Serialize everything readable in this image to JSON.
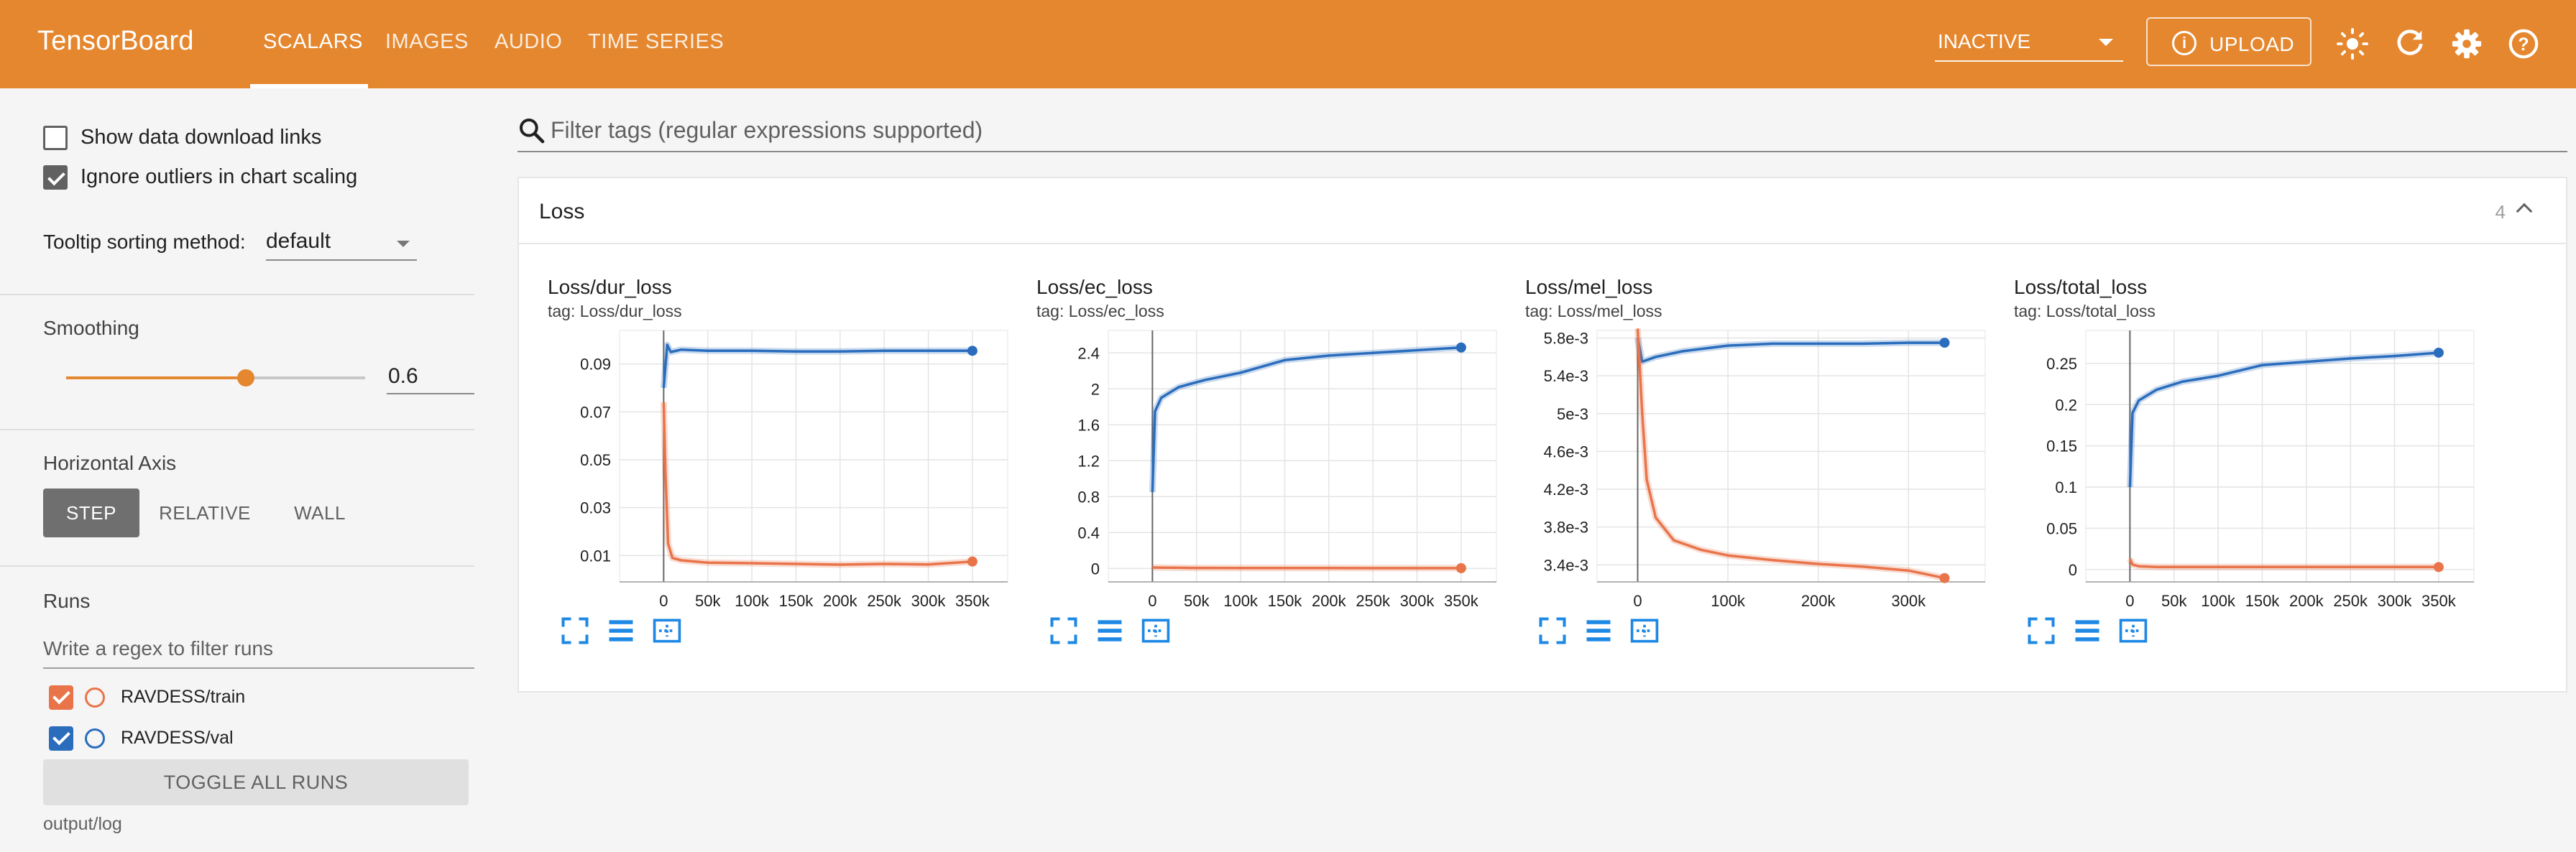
{
  "app": {
    "title": "TensorBoard",
    "tabs": [
      {
        "label": "SCALARS",
        "active": true
      },
      {
        "label": "IMAGES",
        "active": false
      },
      {
        "label": "AUDIO",
        "active": false
      },
      {
        "label": "TIME SERIES",
        "active": false
      }
    ],
    "run_status": "INACTIVE",
    "upload_label": "UPLOAD",
    "accent_color": "#e5872f",
    "icons": [
      "theme-brightness-icon",
      "refresh-icon",
      "settings-gear-icon",
      "help-icon"
    ]
  },
  "sidebar": {
    "show_download_links": {
      "label": "Show data download links",
      "checked": false
    },
    "ignore_outliers": {
      "label": "Ignore outliers in chart scaling",
      "checked": true
    },
    "tooltip_sorting": {
      "label": "Tooltip sorting method:",
      "value": "default"
    },
    "smoothing": {
      "label": "Smoothing",
      "value": "0.6",
      "level": 0.6
    },
    "horizontal_axis": {
      "label": "Horizontal Axis",
      "options": [
        "STEP",
        "RELATIVE",
        "WALL"
      ],
      "selected": "STEP"
    },
    "runs": {
      "label": "Runs",
      "filter_placeholder": "Write a regex to filter runs",
      "items": [
        {
          "name": "RAVDESS/train",
          "color": "#e9744a",
          "checked": true
        },
        {
          "name": "RAVDESS/val",
          "color": "#2a6dbd",
          "checked": true
        }
      ],
      "toggle_label": "TOGGLE ALL RUNS",
      "log_dir": "output/log"
    }
  },
  "main": {
    "filter_placeholder": "Filter tags (regular expressions supported)",
    "group": {
      "title": "Loss",
      "count": "4"
    }
  },
  "chart_data": [
    {
      "type": "line",
      "title": "Loss/dur_loss",
      "tag": "tag: Loss/dur_loss",
      "xlabel": "",
      "ylabel": "",
      "xlim": [
        -50000,
        390000
      ],
      "ylim": [
        -0.001,
        0.104
      ],
      "xticks": [
        0,
        50000,
        100000,
        150000,
        200000,
        250000,
        300000,
        350000
      ],
      "xtick_labels": [
        "0",
        "50k",
        "100k",
        "150k",
        "200k",
        "250k",
        "300k",
        "350k"
      ],
      "yticks": [
        0.01,
        0.03,
        0.05,
        0.07,
        0.09
      ],
      "ytick_labels": [
        "0.01",
        "0.03",
        "0.05",
        "0.07",
        "0.09"
      ],
      "grid": true,
      "series": [
        {
          "name": "RAVDESS/val",
          "color": "#2a6dbd",
          "x": [
            0,
            4000,
            8000,
            20000,
            50000,
            100000,
            150000,
            200000,
            250000,
            300000,
            350000
          ],
          "y": [
            0.08,
            0.098,
            0.095,
            0.096,
            0.0955,
            0.0955,
            0.0952,
            0.0952,
            0.0955,
            0.0955,
            0.0955
          ]
        },
        {
          "name": "RAVDESS/train",
          "color": "#e9744a",
          "x": [
            0,
            2000,
            5000,
            10000,
            20000,
            50000,
            100000,
            150000,
            200000,
            250000,
            300000,
            350000
          ],
          "y": [
            0.074,
            0.045,
            0.015,
            0.009,
            0.008,
            0.007,
            0.0068,
            0.0065,
            0.0062,
            0.0065,
            0.0063,
            0.0075
          ]
        }
      ]
    },
    {
      "type": "line",
      "title": "Loss/ec_loss",
      "tag": "tag: Loss/ec_loss",
      "xlabel": "",
      "ylabel": "",
      "xlim": [
        -50000,
        390000
      ],
      "ylim": [
        -0.15,
        2.65
      ],
      "xticks": [
        0,
        50000,
        100000,
        150000,
        200000,
        250000,
        300000,
        350000
      ],
      "xtick_labels": [
        "0",
        "50k",
        "100k",
        "150k",
        "200k",
        "250k",
        "300k",
        "350k"
      ],
      "yticks": [
        0,
        0.4,
        0.8,
        1.2,
        1.6,
        2,
        2.4
      ],
      "ytick_labels": [
        "0",
        "0.4",
        "0.8",
        "1.2",
        "1.6",
        "2",
        "2.4"
      ],
      "grid": true,
      "series": [
        {
          "name": "RAVDESS/val",
          "color": "#2a6dbd",
          "x": [
            0,
            3000,
            10000,
            30000,
            60000,
            100000,
            150000,
            200000,
            250000,
            300000,
            350000
          ],
          "y": [
            0.85,
            1.75,
            1.9,
            2.02,
            2.1,
            2.18,
            2.32,
            2.37,
            2.4,
            2.43,
            2.46
          ]
        },
        {
          "name": "RAVDESS/train",
          "color": "#e9744a",
          "x": [
            0,
            50000,
            100000,
            150000,
            200000,
            250000,
            300000,
            350000
          ],
          "y": [
            0.01,
            0.005,
            0.004,
            0.004,
            0.004,
            0.003,
            0.003,
            0.003
          ]
        }
      ]
    },
    {
      "type": "line",
      "title": "Loss/mel_loss",
      "tag": "tag: Loss/mel_loss",
      "xlabel": "",
      "ylabel": "",
      "xlim": [
        -45000,
        385000
      ],
      "ylim": [
        0.00322,
        0.00588
      ],
      "xticks": [
        0,
        100000,
        200000,
        300000
      ],
      "xtick_labels": [
        "0",
        "100k",
        "200k",
        "300k"
      ],
      "yticks": [
        0.0034,
        0.0038,
        0.0042,
        0.0046,
        0.005,
        0.0054,
        0.0058
      ],
      "ytick_labels": [
        "3.4e-3",
        "3.8e-3",
        "4.2e-3",
        "4.6e-3",
        "5e-3",
        "5.4e-3",
        "5.8e-3"
      ],
      "grid": true,
      "series": [
        {
          "name": "RAVDESS/val",
          "color": "#2a6dbd",
          "x": [
            0,
            5000,
            20000,
            50000,
            100000,
            150000,
            200000,
            250000,
            300000,
            340000
          ],
          "y": [
            0.0058,
            0.00555,
            0.0056,
            0.00566,
            0.00572,
            0.00574,
            0.00574,
            0.00574,
            0.00575,
            0.00575
          ]
        },
        {
          "name": "RAVDESS/train",
          "color": "#e9744a",
          "x": [
            0,
            5000,
            10000,
            20000,
            40000,
            70000,
            100000,
            150000,
            200000,
            250000,
            300000,
            340000
          ],
          "y": [
            0.0059,
            0.005,
            0.0043,
            0.0039,
            0.00366,
            0.00356,
            0.0035,
            0.00345,
            0.00341,
            0.00338,
            0.00334,
            0.00326
          ]
        }
      ]
    },
    {
      "type": "line",
      "title": "Loss/total_loss",
      "tag": "tag: Loss/total_loss",
      "xlabel": "",
      "ylabel": "",
      "xlim": [
        -50000,
        390000
      ],
      "ylim": [
        -0.015,
        0.29
      ],
      "xticks": [
        0,
        50000,
        100000,
        150000,
        200000,
        250000,
        300000,
        350000
      ],
      "xtick_labels": [
        "0",
        "50k",
        "100k",
        "150k",
        "200k",
        "250k",
        "300k",
        "350k"
      ],
      "yticks": [
        0,
        0.05,
        0.1,
        0.15,
        0.2,
        0.25
      ],
      "ytick_labels": [
        "0",
        "0.05",
        "0.1",
        "0.15",
        "0.2",
        "0.25"
      ],
      "grid": true,
      "series": [
        {
          "name": "RAVDESS/val",
          "color": "#2a6dbd",
          "x": [
            0,
            3000,
            10000,
            30000,
            60000,
            100000,
            150000,
            200000,
            250000,
            300000,
            350000
          ],
          "y": [
            0.1,
            0.19,
            0.205,
            0.218,
            0.228,
            0.235,
            0.248,
            0.252,
            0.256,
            0.259,
            0.263
          ]
        },
        {
          "name": "RAVDESS/train",
          "color": "#e9744a",
          "x": [
            0,
            3000,
            10000,
            30000,
            100000,
            200000,
            300000,
            350000
          ],
          "y": [
            0.013,
            0.006,
            0.004,
            0.003,
            0.003,
            0.003,
            0.003,
            0.003
          ]
        }
      ]
    }
  ]
}
